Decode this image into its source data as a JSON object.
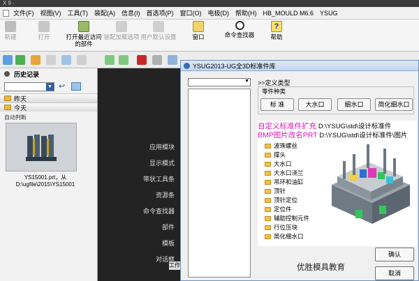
{
  "window": {
    "title": "X 9 -"
  },
  "menubar": {
    "items": [
      "文件(F)",
      "视图(V)",
      "工具(T)",
      "装配(A)",
      "信息(I)",
      "首选项(P)",
      "窗口(O)",
      "电极(D)",
      "帮助(H)",
      "HB_MOULD M6.6",
      "YSUG"
    ]
  },
  "ribbon": {
    "new_label": "新建",
    "open_label": "打开",
    "recent_label": "打开最近访问的部件",
    "load_opts_label": "装配加载选项",
    "user_defaults_label": "用户默认设置",
    "window_label": "窗口",
    "cmd_finder_label": "命令查找器",
    "help_label": "帮助"
  },
  "history": {
    "title": "历史记录",
    "yesterday": "昨天",
    "today": "今天",
    "auto_label": "自动判断",
    "file_caption_1": "YS15001.prt，从",
    "file_caption_2": "D:\\ugfile\\2015\\YS15001"
  },
  "side_menu": {
    "items": [
      "应用模块",
      "显示模式",
      "带状工具条",
      "资源条",
      "命令查找器",
      "部件",
      "模板",
      "对话框"
    ]
  },
  "dialog": {
    "title": "YSUG2013-UG全3D标准件库",
    "define_type": ">>定义类型",
    "parts_group": "零件种类",
    "btn_standard": "标 准",
    "btn_big_gate": "大水口",
    "btn_fine_gate": "细水口",
    "btn_simplified": "简化细水口",
    "custom_ext_label": "自定义标准件扩充",
    "custom_ext_path": "D:\\YSUG\\std\\设计标准件",
    "bmp_label": "BMP图片改名PRT",
    "bmp_path": "D:\\YSUG\\std\\设计标准件\\图片",
    "categories": [
      "波珠螺丝",
      "撑头",
      "大水口",
      "大水口浇兰",
      "吊环和油缸",
      "顶针",
      "顶针定位",
      "定位件",
      "辅助控制元件",
      "行位压块",
      "简化细水口"
    ],
    "watermark": "优胜模具教育",
    "ok": "确认",
    "cancel": "取消"
  },
  "bottom_tab": {
    "label": "工作"
  }
}
